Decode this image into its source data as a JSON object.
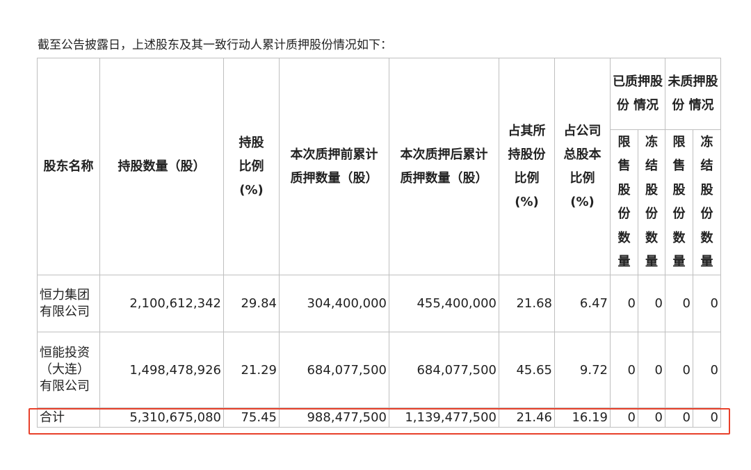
{
  "intro": "截至公告披露日，上述股东及其一致行动人累计质押股份情况如下：",
  "headers": {
    "name": "股东名称",
    "shares": "持股数量（股）",
    "ratio": "持股 比例 (%)",
    "before": "本次质押前累计质押数量（股）",
    "after": "本次质押后累计质押数量（股）",
    "own_ratio": "占其所持股份比例 (%)",
    "total_ratio": "占公司总股本比例 (%)",
    "pledged_group": "已质押股份 情况",
    "unpledged_group": "未质押股份 情况",
    "restricted": "限售股份数量",
    "frozen": "冻结股份数量"
  },
  "rows": [
    {
      "name": "恒力集团有限公司",
      "shares": "2,100,612,342",
      "ratio": "29.84",
      "before": "304,400,000",
      "after": "455,400,000",
      "own_ratio": "21.68",
      "total_ratio": "6.47",
      "p_restricted": "0",
      "p_frozen": "0",
      "u_restricted": "0",
      "u_frozen": "0"
    },
    {
      "name": "恒能投资（大连）有限公司",
      "shares": "1,498,478,926",
      "ratio": "21.29",
      "before": "684,077,500",
      "after": "684,077,500",
      "own_ratio": "45.65",
      "total_ratio": "9.72",
      "p_restricted": "0",
      "p_frozen": "0",
      "u_restricted": "0",
      "u_frozen": "0"
    },
    {
      "name": "合计",
      "shares": "5,310,675,080",
      "ratio": "75.45",
      "before": "988,477,500",
      "after": "1,139,477,500",
      "own_ratio": "21.46",
      "total_ratio": "16.19",
      "p_restricted": "0",
      "p_frozen": "0",
      "u_restricted": "0",
      "u_frozen": "0"
    }
  ],
  "colors": {
    "highlight": "#e8402a",
    "border": "#bfbfbf"
  }
}
